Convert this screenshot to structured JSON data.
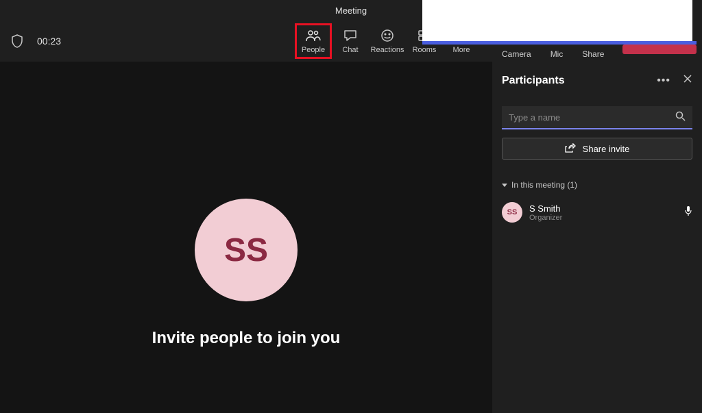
{
  "title": "Meeting",
  "timer": "00:23",
  "toolbar": {
    "people": "People",
    "chat": "Chat",
    "reactions": "Reactions",
    "rooms": "Rooms",
    "more": "More",
    "camera": "Camera",
    "mic": "Mic",
    "share": "Share"
  },
  "main": {
    "avatar_initials": "SS",
    "invite_heading": "Invite people to join you"
  },
  "panel": {
    "title": "Participants",
    "search_placeholder": "Type a name",
    "share_invite": "Share invite",
    "section_label": "In this meeting (1)",
    "participants": [
      {
        "initials": "SS",
        "name": "S Smith",
        "role": "Organizer"
      }
    ]
  }
}
